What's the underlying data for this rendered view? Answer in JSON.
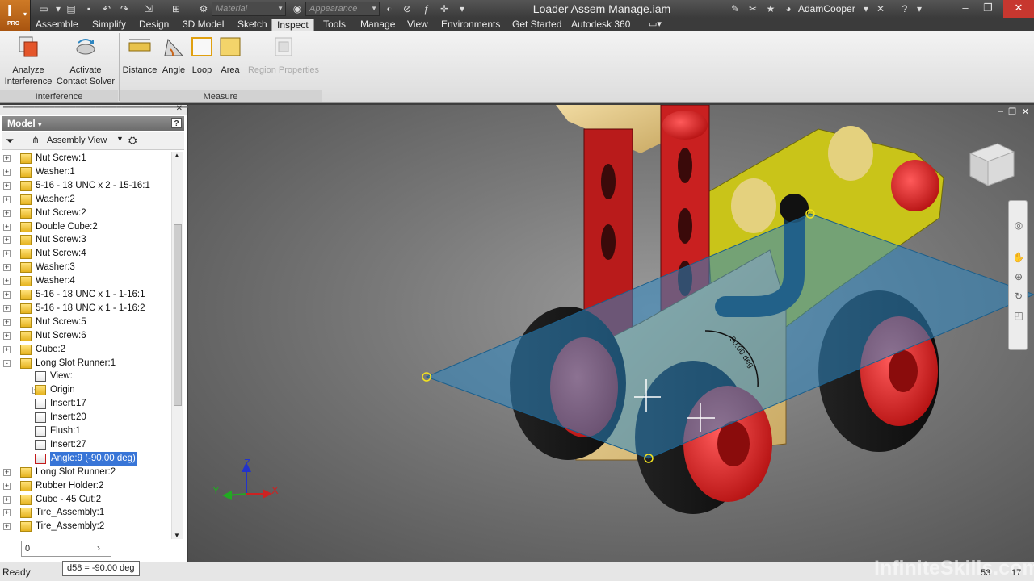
{
  "app": {
    "document_title": "Loader Assem Manage.iam",
    "material_placeholder": "Material",
    "appearance_placeholder": "Appearance",
    "user": "AdamCooper",
    "logo_sub": "PRO"
  },
  "tabs": [
    "Assemble",
    "Simplify",
    "Design",
    "3D Model",
    "Sketch",
    "Inspect",
    "Tools",
    "Manage",
    "View",
    "Environments",
    "Get Started",
    "Autodesk 360"
  ],
  "active_tab": "Inspect",
  "ribbon": {
    "interference": {
      "analyze_label_1": "Analyze",
      "analyze_label_2": "Interference",
      "contact_label_1": "Activate",
      "contact_label_2": "Contact Solver",
      "panel_title": "Interference"
    },
    "measure": {
      "distance": "Distance",
      "angle": "Angle",
      "loop": "Loop",
      "area": "Area",
      "region": "Region Properties",
      "panel_title": "Measure"
    }
  },
  "browser": {
    "title": "Model",
    "view_mode": "Assembly View",
    "items": [
      {
        "label": "Nut Screw:1",
        "level": 0,
        "exp": "+"
      },
      {
        "label": "Washer:1",
        "level": 0,
        "exp": "+"
      },
      {
        "label": "5-16 - 18 UNC x 2 - 15-16:1",
        "level": 0,
        "exp": "+"
      },
      {
        "label": "Washer:2",
        "level": 0,
        "exp": "+"
      },
      {
        "label": "Nut Screw:2",
        "level": 0,
        "exp": "+"
      },
      {
        "label": "Double Cube:2",
        "level": 0,
        "exp": "+"
      },
      {
        "label": "Nut Screw:3",
        "level": 0,
        "exp": "+"
      },
      {
        "label": "Nut Screw:4",
        "level": 0,
        "exp": "+"
      },
      {
        "label": "Washer:3",
        "level": 0,
        "exp": "+"
      },
      {
        "label": "Washer:4",
        "level": 0,
        "exp": "+"
      },
      {
        "label": "5-16 - 18 UNC x 1 - 1-16:1",
        "level": 0,
        "exp": "+"
      },
      {
        "label": "5-16 - 18 UNC x 1 - 1-16:2",
        "level": 0,
        "exp": "+"
      },
      {
        "label": "Nut Screw:5",
        "level": 0,
        "exp": "+"
      },
      {
        "label": "Nut Screw:6",
        "level": 0,
        "exp": "+"
      },
      {
        "label": "Cube:2",
        "level": 0,
        "exp": "+"
      },
      {
        "label": "Long Slot Runner:1",
        "level": 0,
        "exp": "-"
      },
      {
        "label": "View:",
        "level": 1,
        "exp": ""
      },
      {
        "label": "Origin",
        "level": 1,
        "exp": "+"
      },
      {
        "label": "Insert:17",
        "level": 1,
        "exp": ""
      },
      {
        "label": "Insert:20",
        "level": 1,
        "exp": ""
      },
      {
        "label": "Flush:1",
        "level": 1,
        "exp": ""
      },
      {
        "label": "Insert:27",
        "level": 1,
        "exp": ""
      },
      {
        "label": "Angle:9 (-90.00 deg)",
        "level": 1,
        "exp": "",
        "selected": true
      },
      {
        "label": "Long Slot Runner:2",
        "level": 0,
        "exp": "+"
      },
      {
        "label": "Rubber Holder:2",
        "level": 0,
        "exp": "+"
      },
      {
        "label": "Cube - 45 Cut:2",
        "level": 0,
        "exp": "+"
      },
      {
        "label": "Tire_Assembly:1",
        "level": 0,
        "exp": "+"
      },
      {
        "label": "Tire_Assembly:2",
        "level": 0,
        "exp": "+"
      }
    ],
    "input_value": "0"
  },
  "viewport": {
    "axis_x": "X",
    "axis_y": "Y",
    "axis_z": "Z",
    "angle_annotation": "90.00 deg"
  },
  "status": {
    "text": "Ready",
    "tooltip": "d58 = -90.00 deg",
    "count1": "53",
    "count2": "17",
    "watermark": "InfiniteSkills.com"
  },
  "colors": {
    "accent": "#c8651b",
    "selection": "#3875d7",
    "red_part": "#c41a1a",
    "yellow_part": "#c8c418",
    "plane": "#2e86c1"
  }
}
